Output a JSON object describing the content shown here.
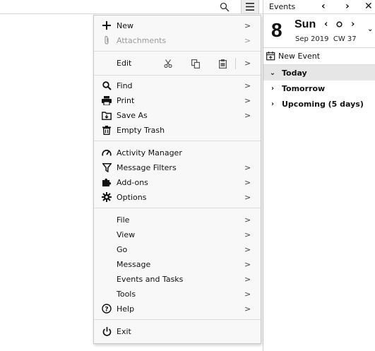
{
  "panel": {
    "title": "Events",
    "day_number": "8",
    "day_name": "Sun",
    "month_year": "Sep 2019",
    "week": "CW 37",
    "new_event_label": "New Event",
    "agenda": [
      {
        "label": "Today",
        "expanded": true
      },
      {
        "label": "Tomorrow",
        "expanded": false
      },
      {
        "label": "Upcoming (5 days)",
        "expanded": false
      }
    ]
  },
  "menu": {
    "new": "New",
    "attachments": "Attachments",
    "edit": "Edit",
    "find": "Find",
    "print": "Print",
    "save_as": "Save As",
    "empty_trash": "Empty Trash",
    "activity_manager": "Activity Manager",
    "message_filters": "Message Filters",
    "addons": "Add-ons",
    "options": "Options",
    "file": "File",
    "view": "View",
    "go": "Go",
    "message": "Message",
    "events_and_tasks": "Events and Tasks",
    "tools": "Tools",
    "help": "Help",
    "exit": "Exit",
    "arrow": ">"
  }
}
